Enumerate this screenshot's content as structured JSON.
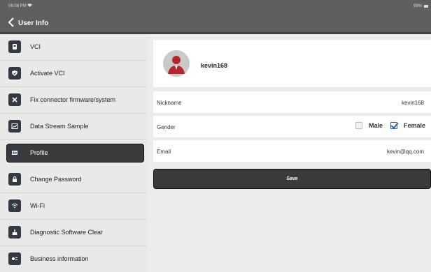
{
  "status": {
    "time": "06:06 PM",
    "battery": "99%"
  },
  "header": {
    "title": "User Info"
  },
  "sidebar": {
    "items": [
      {
        "label": "VCI",
        "icon": "vci-icon"
      },
      {
        "label": "Activate VCI",
        "icon": "shield-check-icon"
      },
      {
        "label": "Fix connector firmware/system",
        "icon": "tools-icon"
      },
      {
        "label": "Data Stream Sample",
        "icon": "chart-icon"
      },
      {
        "label": "Profile",
        "icon": "profile-card-icon",
        "active": true
      },
      {
        "label": "Change Password",
        "icon": "lock-icon"
      },
      {
        "label": "Wi-Fi",
        "icon": "wifi-icon"
      },
      {
        "label": "Diagnostic Software Clear",
        "icon": "broom-icon"
      },
      {
        "label": "Business information",
        "icon": "business-icon"
      }
    ]
  },
  "profile": {
    "username": "kevin168",
    "fields": {
      "nickname_label": "Nickname",
      "nickname_value": "kevin168",
      "gender_label": "Gender",
      "gender_male": "Male",
      "gender_female": "Female",
      "gender_selected": "Female",
      "email_label": "Email",
      "email_value": "kevin@qq.com"
    },
    "save_label": "Save"
  },
  "colors": {
    "header_bg": "#5f5f5f",
    "active_bg": "#3a3a3a",
    "icon_bg": "#333a43",
    "checkbox_accent": "#2d5fa3",
    "avatar_red": "#b5262c"
  }
}
